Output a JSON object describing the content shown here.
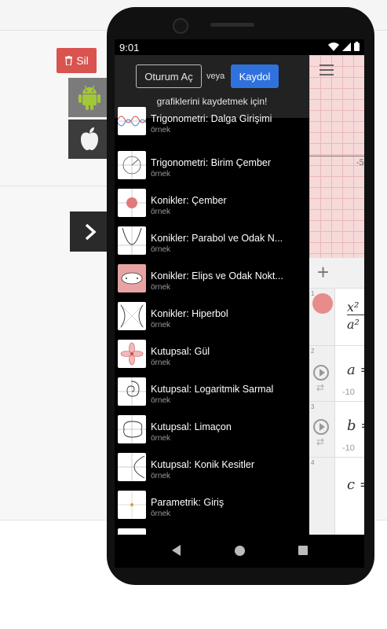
{
  "page": {
    "delete_label": "Sil"
  },
  "status_bar": {
    "time": "9:01"
  },
  "drawer": {
    "login_label": "Oturum Aç",
    "or_label": "veya",
    "signup_label": "Kaydol",
    "save_message": "grafiklerini kaydetmek için!",
    "items": [
      {
        "title": "Trigonometri: Dalga Girişimi",
        "subtitle": "örnek"
      },
      {
        "title": "Trigonometri: Birim Çember",
        "subtitle": "örnek"
      },
      {
        "title": "Konikler: Çember",
        "subtitle": "örnek"
      },
      {
        "title": "Konikler: Parabol ve Odak N...",
        "subtitle": "örnek"
      },
      {
        "title": "Konikler: Elips ve Odak Nokt...",
        "subtitle": "örnek"
      },
      {
        "title": "Konikler: Hiperbol",
        "subtitle": "örnek"
      },
      {
        "title": "Kutupsal: Gül",
        "subtitle": "örnek"
      },
      {
        "title": "Kutupsal: Logaritmik Sarmal",
        "subtitle": "örnek"
      },
      {
        "title": "Kutupsal: Limaçon",
        "subtitle": "örnek"
      },
      {
        "title": "Kutupsal: Konik Kesitler",
        "subtitle": "örnek"
      },
      {
        "title": "Parametrik: Giriş",
        "subtitle": "örnek"
      }
    ]
  },
  "calculator": {
    "axis_label": "-5",
    "add_label": "+",
    "expressions": [
      {
        "num": "1",
        "text": "x²",
        "denom": "a²"
      },
      {
        "num": "2",
        "text": "a =",
        "min": "-10"
      },
      {
        "num": "3",
        "text": "b =",
        "min": "-10"
      },
      {
        "num": "4",
        "text": "c ="
      }
    ]
  }
}
